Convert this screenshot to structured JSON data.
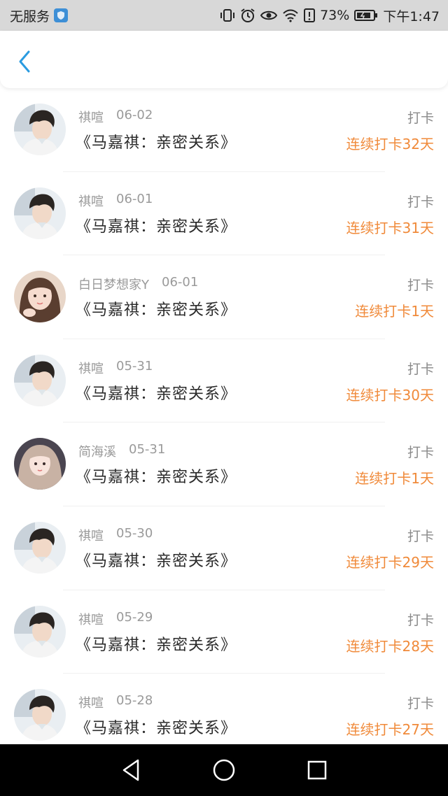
{
  "status_bar": {
    "carrier": "无服务",
    "battery": "73%",
    "time": "下午1:47",
    "icons": [
      "vibrate-icon",
      "alarm-icon",
      "eye-icon",
      "wifi-icon",
      "alert-icon",
      "battery-icon"
    ]
  },
  "header": {
    "back_icon": "chevron-left-icon",
    "accent": "#2a9be0"
  },
  "colors": {
    "streak": "#f08a3a",
    "meta": "#9a9a9a"
  },
  "items": [
    {
      "user": "祺喧",
      "date": "06-02",
      "title": "《马嘉祺：亲密关系》",
      "action": "打卡",
      "streak": "连续打卡32天",
      "avatar": "boy"
    },
    {
      "user": "祺喧",
      "date": "06-01",
      "title": "《马嘉祺：亲密关系》",
      "action": "打卡",
      "streak": "连续打卡31天",
      "avatar": "boy"
    },
    {
      "user": "白日梦想家Y",
      "date": "06-01",
      "title": "《马嘉祺：亲密关系》",
      "action": "打卡",
      "streak": "连续打卡1天",
      "avatar": "girl1"
    },
    {
      "user": "祺喧",
      "date": "05-31",
      "title": "《马嘉祺：亲密关系》",
      "action": "打卡",
      "streak": "连续打卡30天",
      "avatar": "boy"
    },
    {
      "user": "简海溪",
      "date": "05-31",
      "title": "《马嘉祺：亲密关系》",
      "action": "打卡",
      "streak": "连续打卡1天",
      "avatar": "girl2"
    },
    {
      "user": "祺喧",
      "date": "05-30",
      "title": "《马嘉祺：亲密关系》",
      "action": "打卡",
      "streak": "连续打卡29天",
      "avatar": "boy"
    },
    {
      "user": "祺喧",
      "date": "05-29",
      "title": "《马嘉祺：亲密关系》",
      "action": "打卡",
      "streak": "连续打卡28天",
      "avatar": "boy"
    },
    {
      "user": "祺喧",
      "date": "05-28",
      "title": "《马嘉祺：亲密关系》",
      "action": "打卡",
      "streak": "连续打卡27天",
      "avatar": "boy"
    }
  ],
  "nav_bar": {
    "buttons": [
      "back-triangle-icon",
      "home-circle-icon",
      "recents-square-icon"
    ]
  }
}
